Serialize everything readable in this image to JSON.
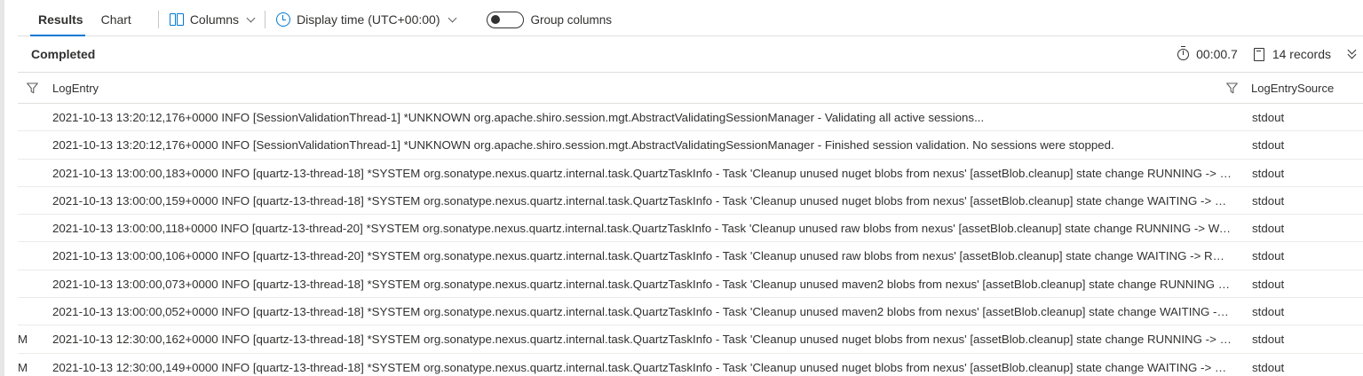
{
  "tabs": [
    {
      "label": "Results"
    },
    {
      "label": "Chart"
    }
  ],
  "toolbar": {
    "columns_label": "Columns",
    "display_time_label": "Display time (UTC+00:00)",
    "group_columns_label": "Group columns"
  },
  "status": {
    "state": "Completed",
    "duration": "00:00.7",
    "records": "14 records"
  },
  "columns": [
    {
      "label": "LogEntry"
    },
    {
      "label": "LogEntrySource"
    }
  ],
  "rows": [
    {
      "cut": "",
      "log": "2021-10-13 13:20:12,176+0000 INFO [SessionValidationThread-1] *UNKNOWN org.apache.shiro.session.mgt.AbstractValidatingSessionManager - Validating all active sessions...",
      "source": "stdout"
    },
    {
      "cut": "",
      "log": "2021-10-13 13:20:12,176+0000 INFO [SessionValidationThread-1] *UNKNOWN org.apache.shiro.session.mgt.AbstractValidatingSessionManager - Finished session validation. No sessions were stopped.",
      "source": "stdout"
    },
    {
      "cut": "",
      "log": "2021-10-13 13:00:00,183+0000 INFO [quartz-13-thread-18] *SYSTEM org.sonatype.nexus.quartz.internal.task.QuartzTaskInfo - Task 'Cleanup unused nuget blobs from nexus' [assetBlob.cleanup] state change RUNNING -> WAITING (OK)",
      "source": "stdout"
    },
    {
      "cut": "",
      "log": "2021-10-13 13:00:00,159+0000 INFO [quartz-13-thread-18] *SYSTEM org.sonatype.nexus.quartz.internal.task.QuartzTaskInfo - Task 'Cleanup unused nuget blobs from nexus' [assetBlob.cleanup] state change WAITING -> RUNNING",
      "source": "stdout"
    },
    {
      "cut": "",
      "log": "2021-10-13 13:00:00,118+0000 INFO [quartz-13-thread-20] *SYSTEM org.sonatype.nexus.quartz.internal.task.QuartzTaskInfo - Task 'Cleanup unused raw blobs from nexus' [assetBlob.cleanup] state change RUNNING -> WAITING (OK)",
      "source": "stdout"
    },
    {
      "cut": "",
      "log": "2021-10-13 13:00:00,106+0000 INFO [quartz-13-thread-20] *SYSTEM org.sonatype.nexus.quartz.internal.task.QuartzTaskInfo - Task 'Cleanup unused raw blobs from nexus' [assetBlob.cleanup] state change WAITING -> RUNNING",
      "source": "stdout"
    },
    {
      "cut": "",
      "log": "2021-10-13 13:00:00,073+0000 INFO [quartz-13-thread-18] *SYSTEM org.sonatype.nexus.quartz.internal.task.QuartzTaskInfo - Task 'Cleanup unused maven2 blobs from nexus' [assetBlob.cleanup] state change RUNNING -> WAITING (OK)",
      "source": "stdout"
    },
    {
      "cut": "",
      "log": "2021-10-13 13:00:00,052+0000 INFO [quartz-13-thread-18] *SYSTEM org.sonatype.nexus.quartz.internal.task.QuartzTaskInfo - Task 'Cleanup unused maven2 blobs from nexus' [assetBlob.cleanup] state change WAITING -> RUNNING",
      "source": "stdout"
    },
    {
      "cut": "M",
      "log": "2021-10-13 12:30:00,162+0000 INFO [quartz-13-thread-18] *SYSTEM org.sonatype.nexus.quartz.internal.task.QuartzTaskInfo - Task 'Cleanup unused nuget blobs from nexus' [assetBlob.cleanup] state change RUNNING -> WAITING (OK)",
      "source": "stdout"
    },
    {
      "cut": "M",
      "log": "2021-10-13 12:30:00,149+0000 INFO [quartz-13-thread-18] *SYSTEM org.sonatype.nexus.quartz.internal.task.QuartzTaskInfo - Task 'Cleanup unused nuget blobs from nexus' [assetBlob.cleanup] state change WAITING -> RUNNING",
      "source": "stdout"
    }
  ]
}
